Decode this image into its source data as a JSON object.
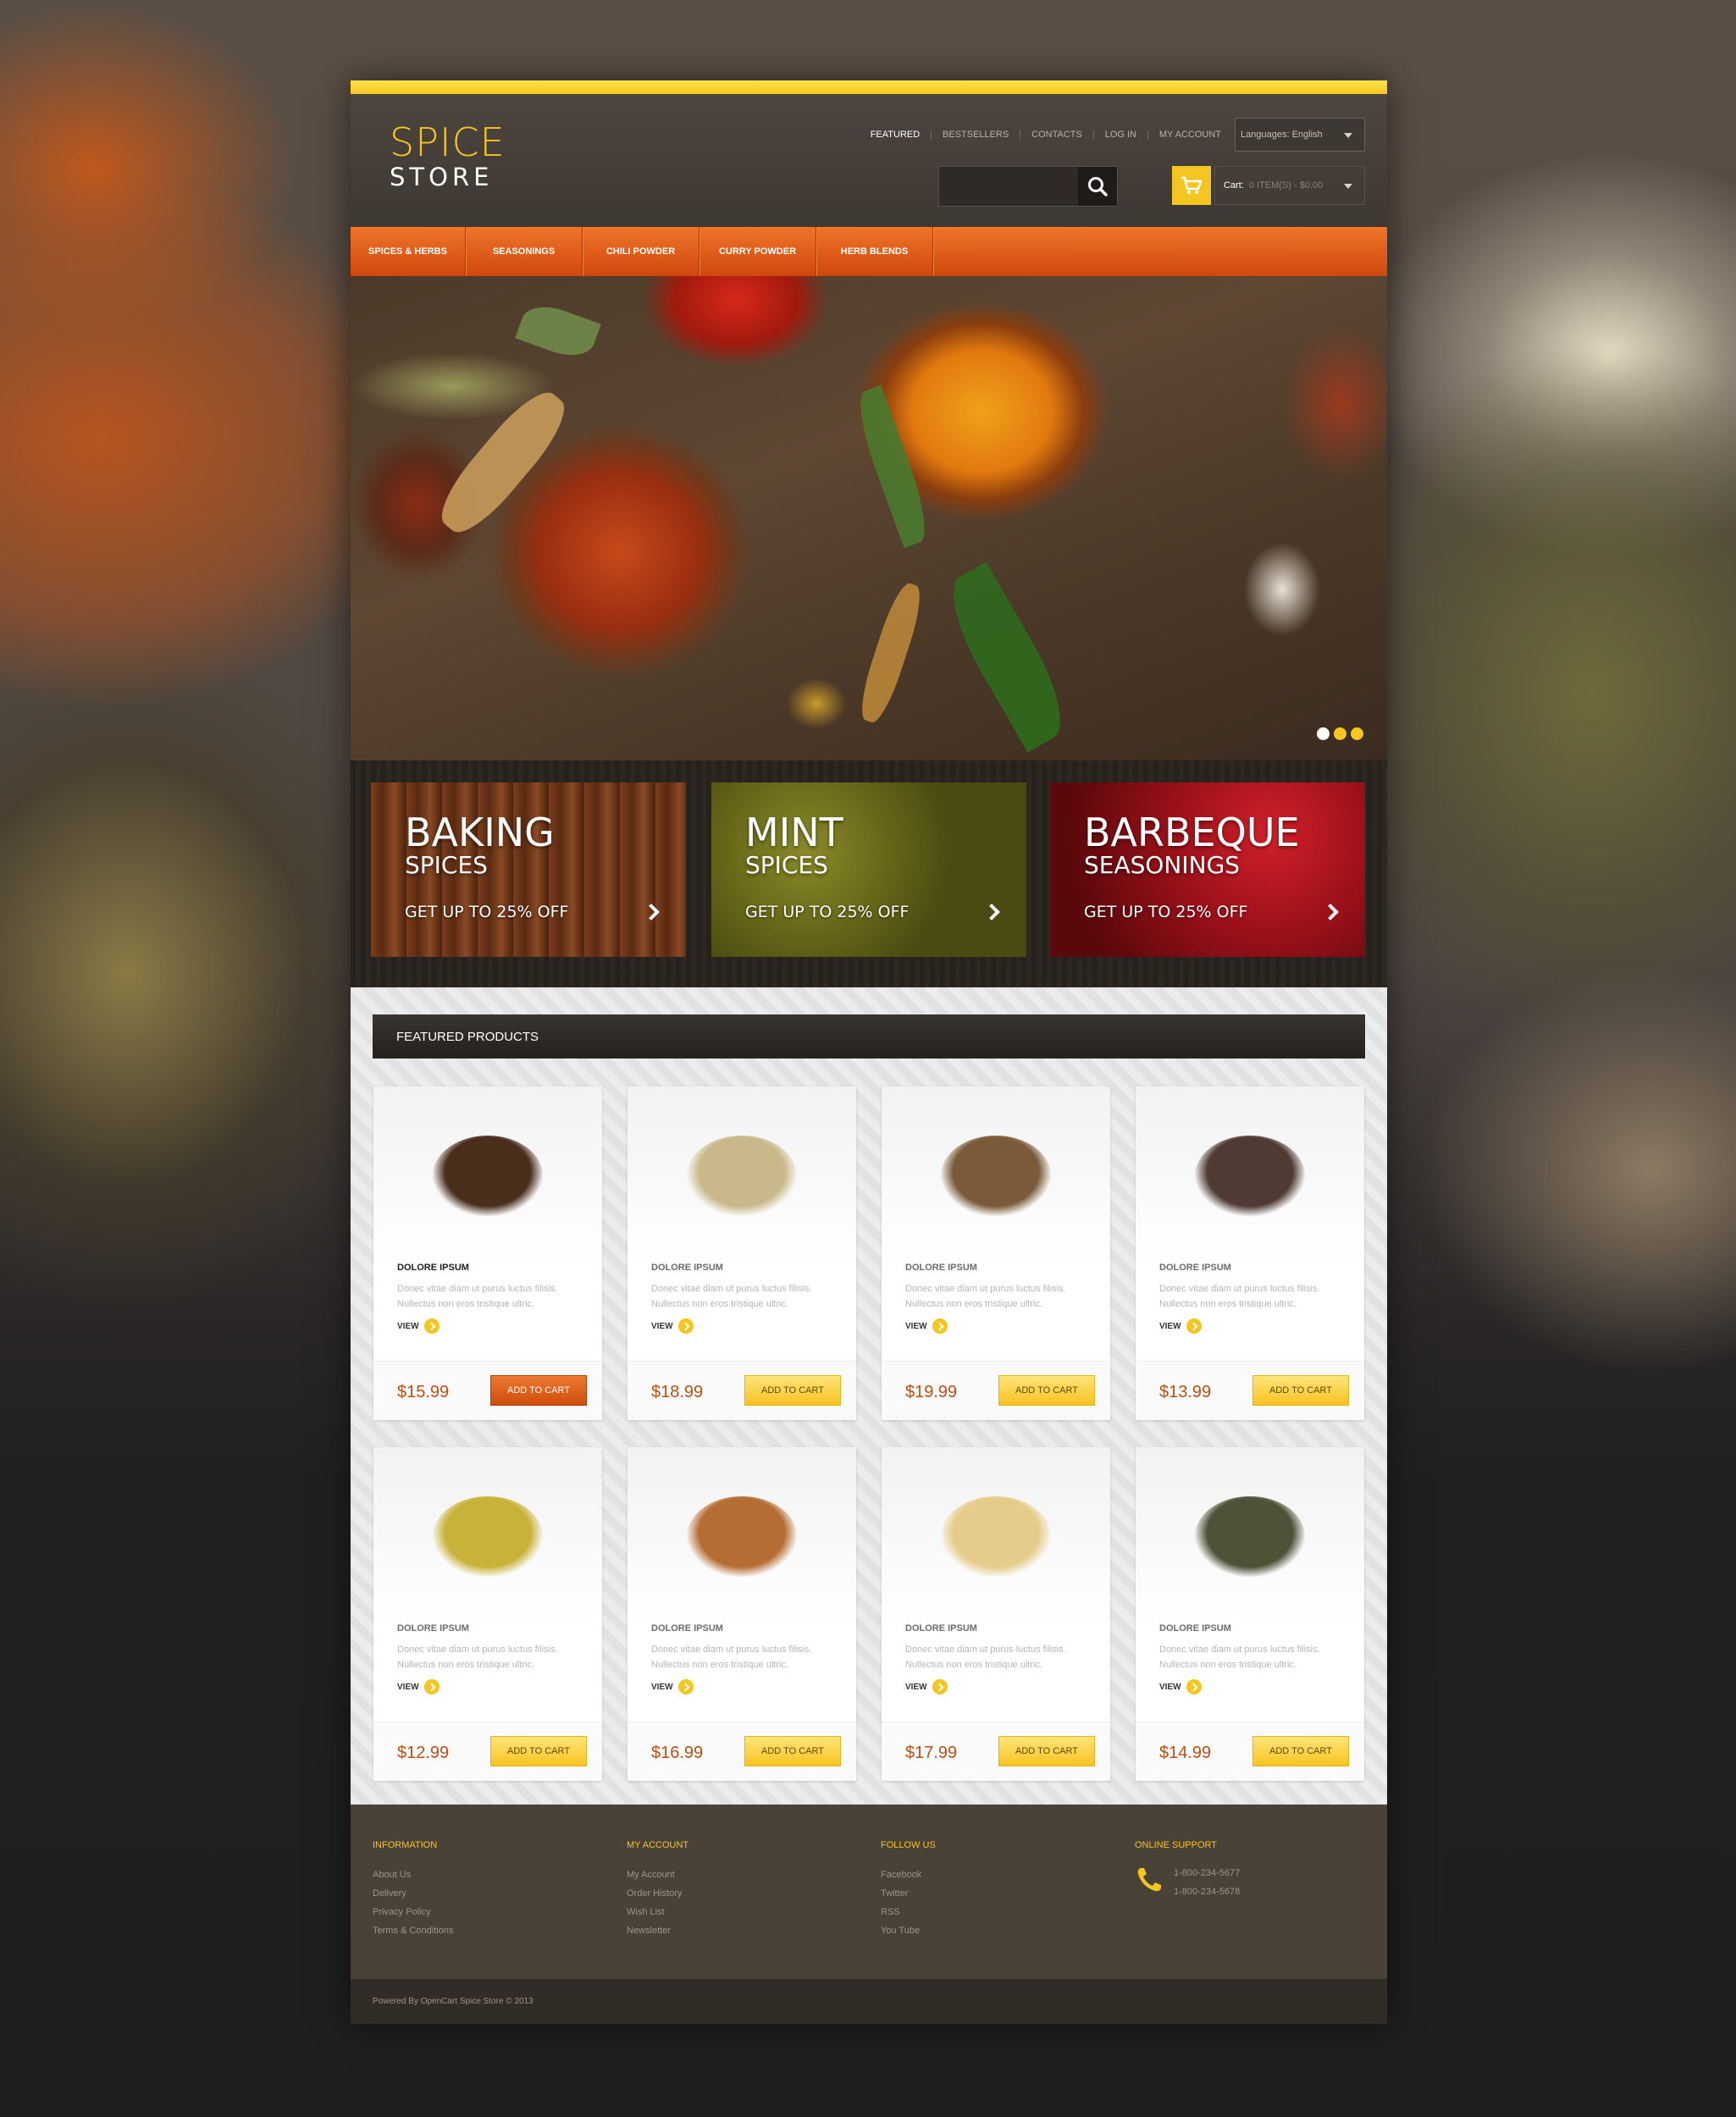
{
  "logo": {
    "line1": "SPICE",
    "line2": "STORE"
  },
  "topnav": [
    {
      "label": "FEATURED"
    },
    {
      "label": "BESTSELLERS"
    },
    {
      "label": "CONTACTS"
    },
    {
      "label": "LOG IN"
    },
    {
      "label": "MY ACCOUNT"
    }
  ],
  "language": {
    "label": "Languages:",
    "value": "English"
  },
  "search": {
    "placeholder": ""
  },
  "cart": {
    "label": "Cart:",
    "value": "0 ITEM(S) - $0.00"
  },
  "mainnav": [
    {
      "label": "SPICES & HERBS"
    },
    {
      "label": "SEASONINGS"
    },
    {
      "label": "CHILI POWDER"
    },
    {
      "label": "CURRY POWDER"
    },
    {
      "label": "HERB BLENDS"
    }
  ],
  "promos": [
    {
      "title": "BAKING",
      "subtitle": "SPICES",
      "offer": "GET UP TO 25% OFF"
    },
    {
      "title": "MINT",
      "subtitle": "SPICES",
      "offer": "GET UP TO 25% OFF"
    },
    {
      "title": "BARBEQUE",
      "subtitle": "SEASONINGS",
      "offer": "GET UP TO 25% OFF"
    }
  ],
  "featured": {
    "title": "FEATURED PRODUCTS",
    "view_label": "VIEW",
    "cart_label": "ADD TO CART",
    "products": [
      {
        "name": "DOLORE IPSUM",
        "desc": "Donec vitae diam ut purus luctus filisis. Nullectus non eros tristique ultric.",
        "price": "$15.99",
        "color": "#4a2e1c"
      },
      {
        "name": "DOLORE IPSUM",
        "desc": "Donec vitae diam ut purus luctus filisis. Nullectus non eros tristique ultric.",
        "price": "$18.99",
        "color": "#c9b98a"
      },
      {
        "name": "DOLORE IPSUM",
        "desc": "Donec vitae diam ut purus luctus filisis. Nullectus non eros tristique ultric.",
        "price": "$19.99",
        "color": "#7a5a38"
      },
      {
        "name": "DOLORE IPSUM",
        "desc": "Donec vitae diam ut purus luctus filisis. Nullectus non eros tristique ultric.",
        "price": "$13.99",
        "color": "#4f3b33"
      },
      {
        "name": "DOLORE IPSUM",
        "desc": "Donec vitae diam ut purus luctus filisis. Nullectus non eros tristique ultric.",
        "price": "$12.99",
        "color": "#c9b23a"
      },
      {
        "name": "DOLORE IPSUM",
        "desc": "Donec vitae diam ut purus luctus filisis. Nullectus non eros tristique ultric.",
        "price": "$16.99",
        "color": "#b66d34"
      },
      {
        "name": "DOLORE IPSUM",
        "desc": "Donec vitae diam ut purus luctus filisis. Nullectus non eros tristique ultric.",
        "price": "$17.99",
        "color": "#e6cc8a"
      },
      {
        "name": "DOLORE IPSUM",
        "desc": "Donec vitae diam ut purus luctus filisis. Nullectus non eros tristique ultric.",
        "price": "$14.99",
        "color": "#4d5338"
      }
    ]
  },
  "footer": {
    "information": {
      "title": "INFORMATION",
      "links": [
        "About Us",
        "Delivery",
        "Privacy Policy",
        "Terms & Conditions"
      ]
    },
    "account": {
      "title": "MY ACCOUNT",
      "links": [
        "My Account",
        "Order History",
        "Wish List",
        "Newsletter"
      ]
    },
    "follow": {
      "title": "FOLLOW US",
      "links": [
        "Facebook",
        "Twitter",
        "RSS",
        "You Tube"
      ]
    },
    "support": {
      "title": "ONLINE SUPPORT",
      "phones": [
        "1-800-234-5677",
        "1-800-234-5678"
      ]
    },
    "copyright": "Powered By OpenCart Spice Store © 2013"
  },
  "colors": {
    "accent": "#f5c521",
    "nav_orange": "#e25f1b",
    "dark": "#3b352f"
  }
}
